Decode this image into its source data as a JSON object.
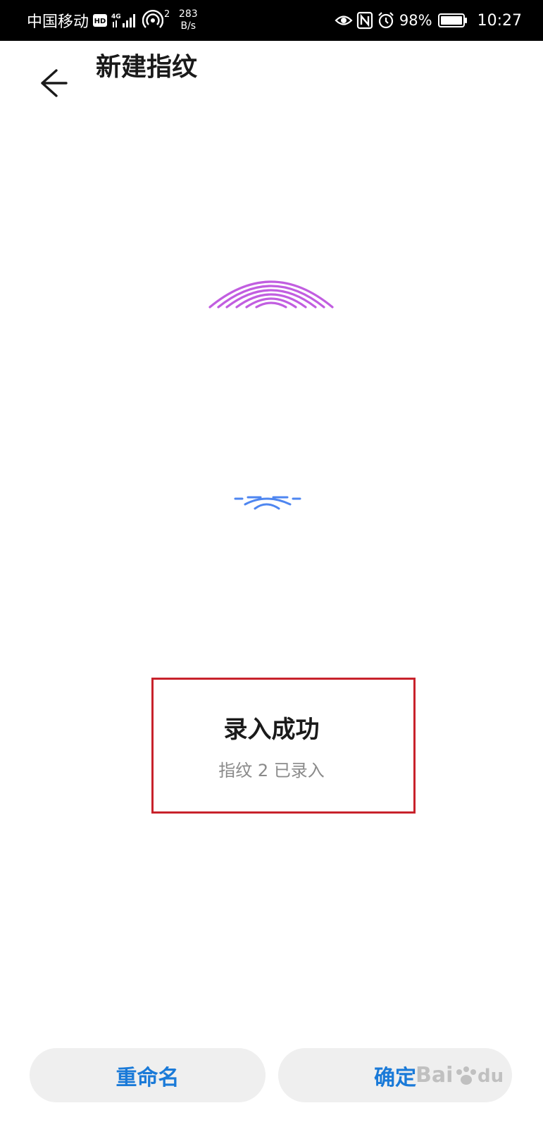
{
  "status_bar": {
    "carrier": "中国移动",
    "hd_badge": "HD",
    "network_type": "4G",
    "hotspot_count": "2",
    "speed_value": "283",
    "speed_unit": "B/s",
    "battery_percent": "98%",
    "time": "10:27",
    "icons": [
      "hd-icon",
      "signal-icon",
      "hotspot-icon",
      "eye-comfort-icon",
      "nfc-icon",
      "alarm-icon",
      "battery-icon"
    ]
  },
  "toolbar": {
    "title": "新建指纹",
    "back_icon": "back-arrow-icon"
  },
  "fingerprint": {
    "icon": "fingerprint-icon",
    "top_color": "#c15ee0",
    "bottom_color": "#4e86f0"
  },
  "result": {
    "title": "录入成功",
    "subtitle": "指纹 2 已录入",
    "highlight_color": "#c8222b"
  },
  "buttons": {
    "rename_label": "重命名",
    "confirm_label": "确定",
    "label_color": "#1a7ad8"
  },
  "watermark": {
    "text": "Baidu经验"
  }
}
